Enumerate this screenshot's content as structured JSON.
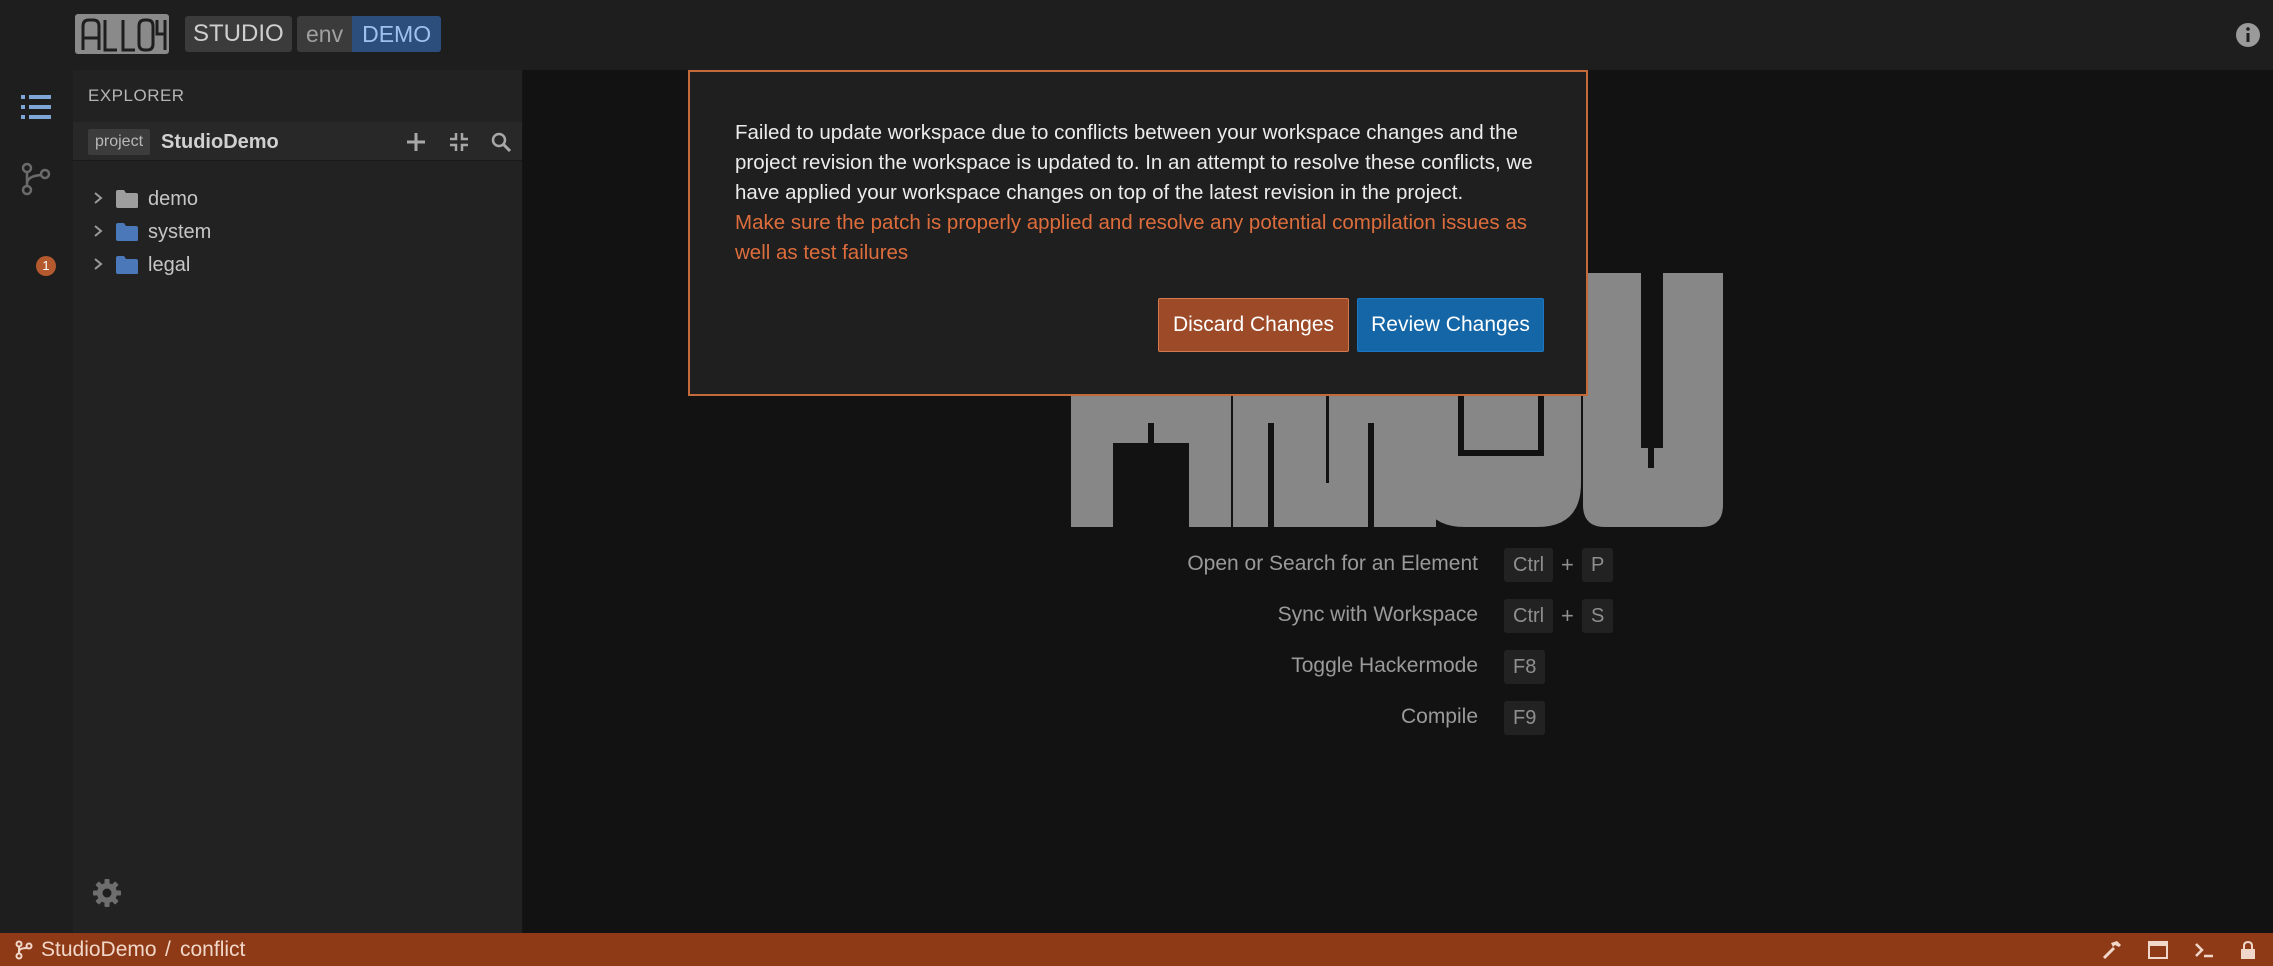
{
  "header": {
    "logo_text": "ALLOY",
    "app_name": "STUDIO",
    "env_key": "env",
    "env_value": "DEMO"
  },
  "activity_bar": {
    "changes_count": "1"
  },
  "explorer": {
    "title": "EXPLORER",
    "project_tag": "project",
    "project_name": "StudioDemo",
    "tree": [
      {
        "label": "demo",
        "folder_color": "#9e9e9e"
      },
      {
        "label": "system",
        "folder_color": "#4a78b8"
      },
      {
        "label": "legal",
        "folder_color": "#4a78b8"
      }
    ]
  },
  "main": {
    "logo_text": "ALLOY",
    "shortcuts": [
      {
        "label": "Open or Search for an Element",
        "keys": [
          "Ctrl",
          "P"
        ]
      },
      {
        "label": "Sync with Workspace",
        "keys": [
          "Ctrl",
          "S"
        ]
      },
      {
        "label": "Toggle Hackermode",
        "keys": [
          "F8"
        ]
      },
      {
        "label": "Compile",
        "keys": [
          "F9"
        ]
      }
    ],
    "plus_sign": "+"
  },
  "dialog": {
    "message": "Failed to update workspace due to conflicts between your workspace changes and the project revision the workspace is updated to. In an attempt to resolve these conflicts, we have applied your workspace changes on top of the latest revision in the project.",
    "warning": "Make sure the patch is properly applied and resolve any potential compilation issues as well as test failures",
    "discard_label": "Discard Changes",
    "review_label": "Review Changes"
  },
  "status_bar": {
    "project": "StudioDemo",
    "separator": "/",
    "branch": "conflict"
  },
  "colors": {
    "accent_orange": "#c26a3a",
    "status_bar": "#8e3a17",
    "primary_blue": "#1466a6",
    "warning_text": "#dd6d3c"
  }
}
